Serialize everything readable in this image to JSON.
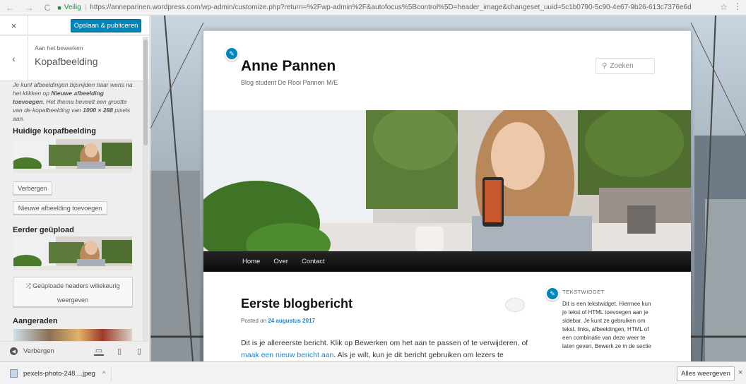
{
  "browser": {
    "nav": "← → C",
    "secure_label": "Veilig",
    "url": "https://anneparinen.wordpress.com/wp-admin/customize.php?return=%2Fwp-admin%2F&autofocus%5Bcontrol%5D=header_image&changeset_uuid=5c1b0790-5c90-4e67-9b26-613c7376e6d",
    "star": "☆",
    "menu": "⋮"
  },
  "sidebar": {
    "close": "×",
    "publish_label": "Opslaan & publiceren",
    "breadcrumb": "Aan het bewerken",
    "section_title": "Kopafbeelding",
    "back": "‹",
    "description_parts": [
      "Je kunt afbeeldingen bijsnijden naar wens na het klikken op ",
      "Nieuwe afbeelding toevoegen",
      ". Het thema beveelt een grootte van de kopafbeelding van ",
      "1000 × 288",
      " pixels aan."
    ],
    "current_header_heading": "Huidige kopafbeelding",
    "hide_button": "Verbergen",
    "add_new_button": "Nieuwe afbeelding toevoegen",
    "uploaded_heading": "Eerder geüpload",
    "randomize_button_line1": "Geüploade headers willekeurig",
    "randomize_button_line2": "weergeven",
    "suggested_heading": "Aangeraden",
    "footer_hide": "Verbergen"
  },
  "site": {
    "title": "Anne Pannen",
    "description": "Blog student De Rooi Pannen M/E",
    "search_placeholder": "Zoeken",
    "nav": [
      "Home",
      "Over",
      "Contact"
    ],
    "post": {
      "title": "Eerste blogbericht",
      "posted_prefix": "Posted on",
      "posted_date": "24 augustus 2017",
      "body_1": "Dit is je allereerste bericht. Klik op Bewerken om het aan te passen of te verwijderen, of ",
      "body_link": "maak een nieuw bericht aan",
      "body_2": ". Als je wilt, kun je dit bericht gebruiken om lezers te"
    },
    "widget": {
      "title": "TEKSTWIDGET",
      "text": "Dit is een tekstwidget. Hiermee kun je tekst of HTML toevoegen aan je sidebar. Je kunt ze gebruiken om tekst, links, afbeeldingen, HTML of een combinatie van deze weer te laten geven. Bewerk ze in de sectie"
    }
  },
  "downloads": {
    "file_name": "pexels-photo-248....jpeg",
    "caret": "^",
    "show_all": "Alles weergeven",
    "close": "×"
  },
  "colors": {
    "accent": "#0085ba",
    "link": "#1982d1",
    "nav_bg": "#111111"
  }
}
